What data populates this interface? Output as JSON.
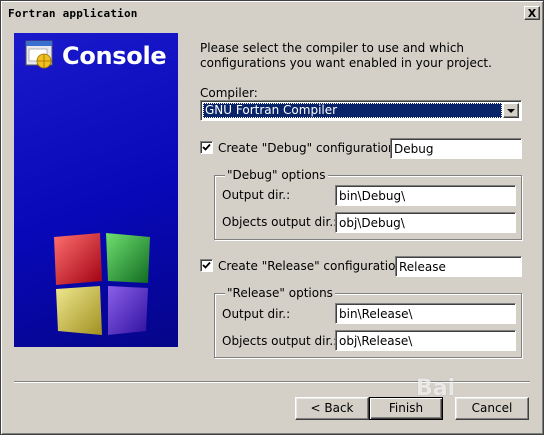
{
  "window": {
    "title": "Fortran application",
    "close_glyph": "X"
  },
  "banner": {
    "title": "Console",
    "icon": "codeblocks-logo-icon",
    "background_color": "#0a0ac0"
  },
  "intro_text": "Please select the compiler to use and which configurations you want enabled in your project.",
  "compiler": {
    "label": "Compiler:",
    "selected": "GNU Fortran Compiler"
  },
  "debug": {
    "checkbox_label": "Create \"Debug\" configuration:",
    "checked": true,
    "config_name": "Debug",
    "group_label": "\"Debug\" options",
    "output_dir_label": "Output dir.:",
    "output_dir": "bin\\Debug\\",
    "objects_dir_label": "Objects output dir.:",
    "objects_dir": "obj\\Debug\\"
  },
  "release": {
    "checkbox_label": "Create \"Release\" configuration:",
    "checked": true,
    "config_name": "Release",
    "group_label": "\"Release\" options",
    "output_dir_label": "Output dir.:",
    "output_dir": "bin\\Release\\",
    "objects_dir_label": "Objects output dir.:",
    "objects_dir": "obj\\Release\\"
  },
  "buttons": {
    "back": "< Back",
    "finish": "Finish",
    "cancel": "Cancel"
  },
  "watermark": "Bai"
}
